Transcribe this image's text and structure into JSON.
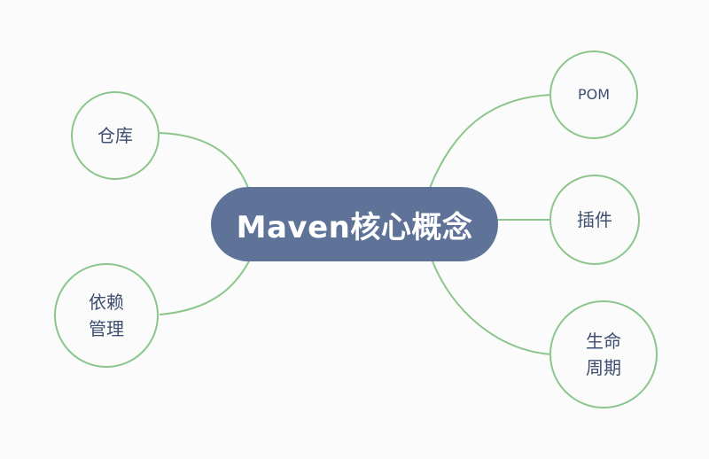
{
  "diagram": {
    "center": {
      "label": "Maven核心概念"
    },
    "nodes": {
      "cangku": {
        "label": "仓库"
      },
      "yilai": {
        "line1": "依赖",
        "line2": "管理"
      },
      "pom": {
        "label": "POM"
      },
      "chajian": {
        "label": "插件"
      },
      "shengming": {
        "line1": "生命",
        "line2": "周期"
      }
    },
    "colors": {
      "center_fill": "#5f7399",
      "link": "#8cc68c",
      "node_text": "#3f4f6f"
    }
  }
}
